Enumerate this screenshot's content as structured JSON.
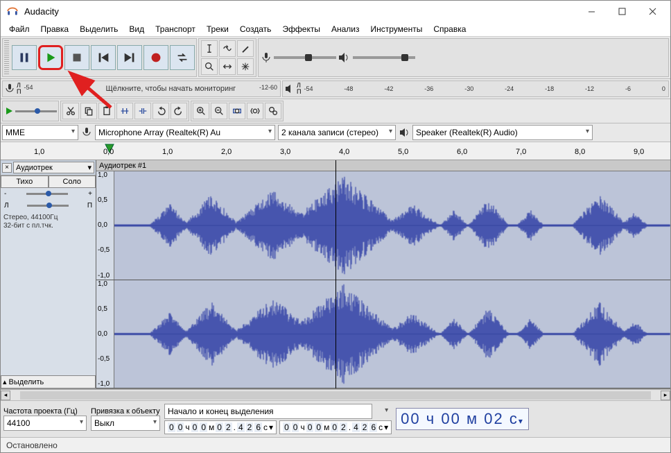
{
  "app": {
    "title": "Audacity"
  },
  "menu": [
    "Файл",
    "Правка",
    "Выделить",
    "Вид",
    "Транспорт",
    "Треки",
    "Создать",
    "Эффекты",
    "Анализ",
    "Инструменты",
    "Справка"
  ],
  "meter": {
    "rec_hint": "Щёлкните, чтобы начать мониторинг",
    "ticks": [
      "-54",
      "-48",
      "-42",
      "-36",
      "-30",
      "-24",
      "-18",
      "-12",
      "-6",
      "0"
    ],
    "lr": [
      "Л",
      "П"
    ]
  },
  "device": {
    "host": "MME",
    "input": "Microphone Array (Realtek(R) Au",
    "channels": "2 канала записи (стерео)",
    "output": "Speaker (Realtek(R) Audio)"
  },
  "ruler": {
    "ticks": [
      "1,0",
      "0,0",
      "1,0",
      "2,0",
      "3,0",
      "4,0",
      "5,0",
      "6,0",
      "7,0",
      "8,0",
      "9,0"
    ]
  },
  "track": {
    "menu_label": "Аудиотрек",
    "mute": "Тихо",
    "solo": "Соло",
    "gain_minus": "-",
    "gain_plus": "+",
    "pan_l": "Л",
    "pan_r": "П",
    "info1": "Стерео, 44100Гц",
    "info2": "32-бит с пл.тчк.",
    "select_btn": "Выделить",
    "header": "Аудиотрек #1",
    "yscale": [
      "1,0",
      "0,5",
      "0,0",
      "-0,5",
      "-1,0"
    ]
  },
  "selection": {
    "rate_label": "Частота проекта (Гц)",
    "rate": "44100",
    "snap_label": "Привязка к объекту",
    "snap": "Выкл",
    "mode": "Начало и конец выделения",
    "time_tpl": [
      "0",
      "0",
      "ч",
      "0",
      "0",
      "м",
      "0",
      "2",
      ".",
      "4",
      "2",
      "6",
      "с"
    ],
    "bigtime": [
      "0",
      "0",
      " ч ",
      "0",
      "0",
      " м ",
      "0",
      "2",
      " с"
    ]
  },
  "status": "Остановлено"
}
